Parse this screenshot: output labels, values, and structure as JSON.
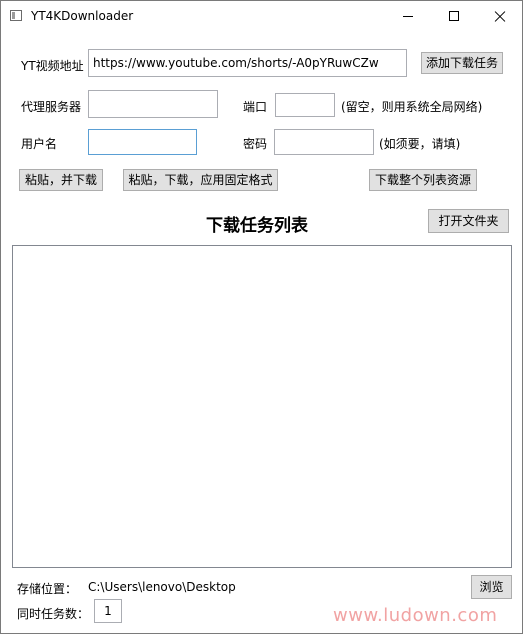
{
  "window": {
    "title": "YT4KDownloader",
    "icons": {
      "app": "window-icon",
      "minimize": "minimize-icon",
      "maximize": "maximize-icon",
      "close": "close-icon"
    }
  },
  "url_row": {
    "label": "YT视频地址",
    "value": "https://www.youtube.com/shorts/-A0pYRuwCZw",
    "add_button": "添加下载任务"
  },
  "proxy_row": {
    "server_label": "代理服务器",
    "server_value": "",
    "port_label": "端口",
    "port_value": "",
    "port_hint": "(留空，则用系统全局网络)"
  },
  "auth_row": {
    "user_label": "用户名",
    "user_value": "",
    "password_label": "密码",
    "password_value": "",
    "password_hint": "(如须要，请填)"
  },
  "action_buttons": {
    "paste_download": "粘贴，并下载",
    "paste_download_format": "粘贴，下载，应用固定格式",
    "download_list": "下载整个列表资源"
  },
  "task_list": {
    "title": "下载任务列表",
    "open_folder": "打开文件夹",
    "items": []
  },
  "footer": {
    "save_label": "存储位置：",
    "save_path": "C:\\Users\\lenovo\\Desktop",
    "browse_button": "浏览",
    "concurrent_label": "同时任务数：",
    "concurrent_value": "1"
  },
  "watermark": "www.ludown.com",
  "colors": {
    "button_bg": "#e1e1e1",
    "focus_border": "#5a9fd4",
    "watermark": "#f1a3a3"
  }
}
